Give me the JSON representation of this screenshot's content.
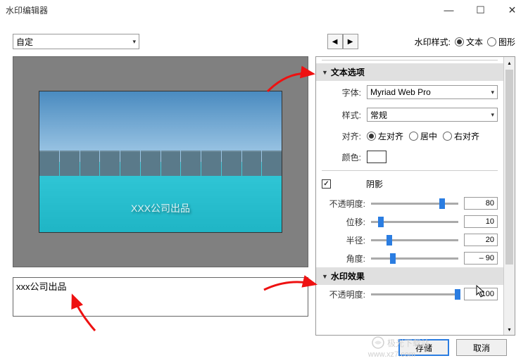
{
  "window": {
    "title": "水印编辑器"
  },
  "preset": {
    "value": "自定"
  },
  "watermark_style": {
    "label": "水印样式:",
    "text_option": "文本",
    "graphic_option": "图形"
  },
  "sections": {
    "text_options": "文本选项",
    "watermark_effects": "水印效果"
  },
  "text_opts": {
    "font_label": "字体:",
    "font_value": "Myriad Web Pro",
    "style_label": "样式:",
    "style_value": "常规",
    "align_label": "对齐:",
    "align_left": "左对齐",
    "align_center": "居中",
    "align_right": "右对齐",
    "color_label": "颜色:",
    "shadow_label": "阴影",
    "opacity_label": "不透明度:",
    "opacity_value": "80",
    "offset_label": "位移:",
    "offset_value": "10",
    "radius_label": "半径:",
    "radius_value": "20",
    "angle_label": "角度:",
    "angle_value": "– 90"
  },
  "effects": {
    "opacity_label": "不透明度:",
    "opacity_value": "100"
  },
  "preview": {
    "watermark_text": "XXX公司出品"
  },
  "input": {
    "text": "xxx公司出品"
  },
  "buttons": {
    "save": "存储",
    "cancel": "取消"
  },
  "branding": {
    "name": "极光下载站",
    "url": "www.xz7.com"
  }
}
